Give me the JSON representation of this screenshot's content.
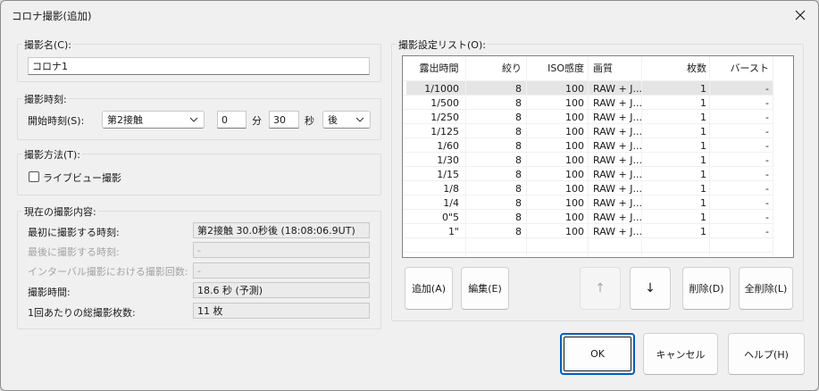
{
  "window": {
    "title": "コロナ撮影(追加)"
  },
  "name_group": {
    "label": "撮影名(C):",
    "value": "コロナ1"
  },
  "time_group": {
    "label": "撮影時刻:",
    "start_label": "開始時刻(S):",
    "contact_value": "第2接触",
    "minutes_value": "0",
    "minutes_unit": "分",
    "seconds_value": "30",
    "seconds_unit": "秒",
    "direction_value": "後"
  },
  "method_group": {
    "label": "撮影方法(T):",
    "liveview_label": "ライブビュー撮影",
    "liveview_checked": false
  },
  "current_group": {
    "label": "現在の撮影内容:",
    "first_label": "最初に撮影する時刻:",
    "first_value": "第2接触 30.0秒後 (18:08:06.9UT)",
    "last_label": "最後に撮影する時刻:",
    "last_value": "-",
    "interval_label": "インターバル撮影における撮影回数:",
    "interval_value": "-",
    "duration_label": "撮影時間:",
    "duration_value": "18.6 秒 (予測)",
    "total_label": "1回あたりの総撮影枚数:",
    "total_value": "11 枚"
  },
  "list_group": {
    "label": "撮影設定リスト(O):",
    "columns": [
      "露出時間",
      "絞り",
      "ISO感度",
      "画質",
      "枚数",
      "バースト"
    ],
    "rows": [
      [
        "1/1000",
        "8",
        "100",
        "RAW + J...",
        "1",
        "-"
      ],
      [
        "1/500",
        "8",
        "100",
        "RAW + J...",
        "1",
        "-"
      ],
      [
        "1/250",
        "8",
        "100",
        "RAW + J...",
        "1",
        "-"
      ],
      [
        "1/125",
        "8",
        "100",
        "RAW + J...",
        "1",
        "-"
      ],
      [
        "1/60",
        "8",
        "100",
        "RAW + J...",
        "1",
        "-"
      ],
      [
        "1/30",
        "8",
        "100",
        "RAW + J...",
        "1",
        "-"
      ],
      [
        "1/15",
        "8",
        "100",
        "RAW + J...",
        "1",
        "-"
      ],
      [
        "1/8",
        "8",
        "100",
        "RAW + J...",
        "1",
        "-"
      ],
      [
        "1/4",
        "8",
        "100",
        "RAW + J...",
        "1",
        "-"
      ],
      [
        "0\"5",
        "8",
        "100",
        "RAW + J...",
        "1",
        "-"
      ],
      [
        "1\"",
        "8",
        "100",
        "RAW + J...",
        "1",
        "-"
      ]
    ],
    "add_label": "追加(A)",
    "edit_label": "編集(E)",
    "up_label": "↑",
    "down_label": "↓",
    "delete_label": "削除(D)",
    "delete_all_label": "全削除(L)"
  },
  "footer": {
    "ok_label": "OK",
    "cancel_label": "キャンセル",
    "help_label": "ヘルプ(H)"
  }
}
